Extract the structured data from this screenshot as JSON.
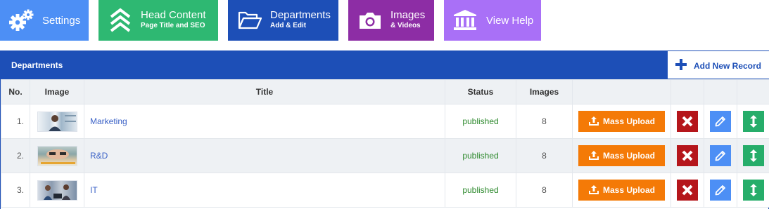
{
  "tiles": {
    "settings": {
      "label": "Settings",
      "icon": "gears-icon"
    },
    "head_content": {
      "label": "Head Content",
      "sub": "Page Title and SEO",
      "icon": "chevrons-up-icon"
    },
    "departments": {
      "label": "Departments",
      "sub": "Add & Edit",
      "icon": "folder-open-icon"
    },
    "images": {
      "label": "Images",
      "sub": "& Videos",
      "icon": "camera-icon"
    },
    "view_help": {
      "label": "View Help",
      "icon": "bank-building-icon"
    }
  },
  "panel": {
    "title": "Departments",
    "add_label": "Add New Record"
  },
  "table": {
    "columns": [
      "No.",
      "Image",
      "Title",
      "Status",
      "Images"
    ],
    "mass_upload_label": "Mass Upload",
    "rows": [
      {
        "no": "1.",
        "title": "Marketing",
        "status": "published",
        "images": "8"
      },
      {
        "no": "2.",
        "title": "R&D",
        "status": "published",
        "images": "8"
      },
      {
        "no": "3.",
        "title": "IT",
        "status": "published",
        "images": "8"
      }
    ]
  },
  "colors": {
    "settings": "#4d8ff5",
    "head_content": "#2eb872",
    "departments": "#1d4fb7",
    "images": "#8d2da5",
    "view_help": "#a970f7",
    "mass_upload": "#f47a07",
    "delete": "#b5161b",
    "edit": "#4d8ff5",
    "move": "#26ad6a",
    "status_published": "#2e8a2e"
  }
}
